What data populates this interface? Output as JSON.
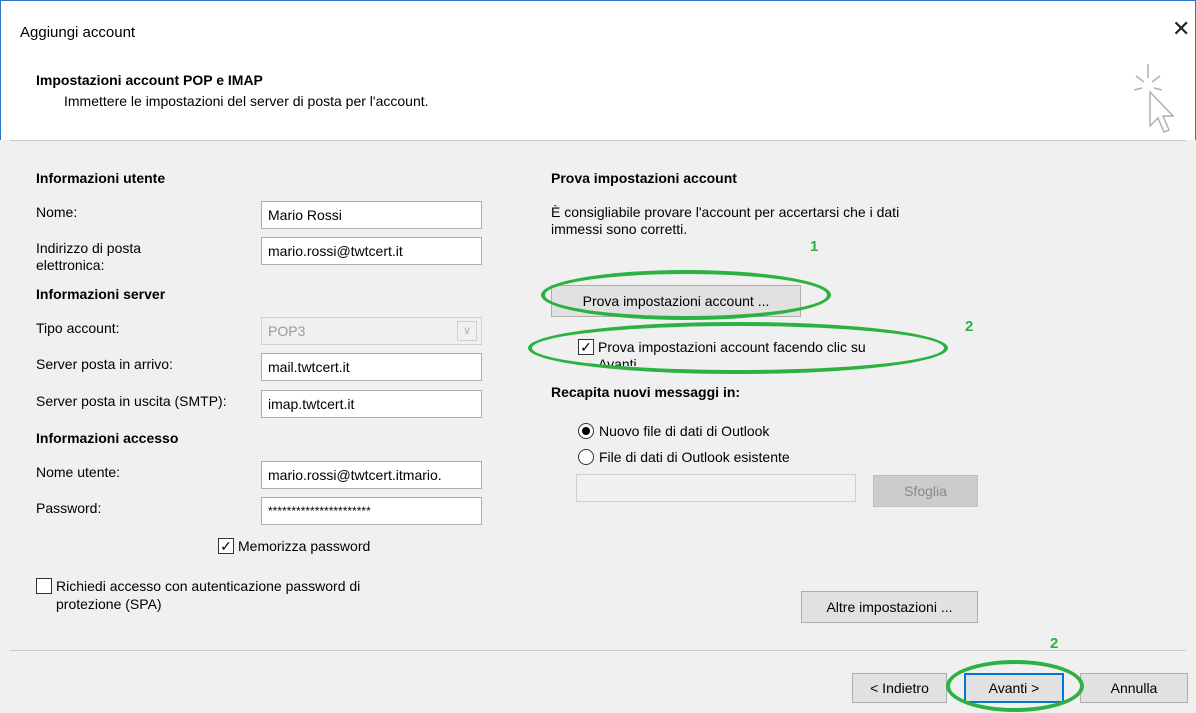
{
  "window": {
    "title": "Aggiungi account",
    "close_icon": "close-icon"
  },
  "header": {
    "heading": "Impostazioni account POP e IMAP",
    "subheading": "Immettere le impostazioni del server di posta per l'account."
  },
  "user_info": {
    "section": "Informazioni utente",
    "name_label": "Nome:",
    "name_value": "Mario Rossi",
    "email_label_1": "Indirizzo di posta",
    "email_label_2": "elettronica:",
    "email_value": "mario.rossi@twtcert.it"
  },
  "server_info": {
    "section": "Informazioni server",
    "account_type_label": "Tipo account:",
    "account_type_value": "POP3",
    "incoming_label": "Server posta in arrivo:",
    "incoming_value": "mail.twtcert.it",
    "outgoing_label": "Server posta in uscita (SMTP):",
    "outgoing_value": "imap.twtcert.it"
  },
  "login_info": {
    "section": "Informazioni accesso",
    "username_label": "Nome utente:",
    "username_value": "mario.rossi@twtcert.itmario.",
    "password_label": "Password:",
    "password_value": "**********************",
    "remember_label": "Memorizza password",
    "remember_checked": true,
    "spa_label_1": "Richiedi accesso con autenticazione password di",
    "spa_label_2": "protezione (SPA)",
    "spa_checked": false
  },
  "test": {
    "section": "Prova impostazioni account",
    "desc_1": "È consigliabile provare l'account per accertarsi che i dati",
    "desc_2": "immessi sono corretti.",
    "test_button": "Prova impostazioni account ...",
    "auto_test_label_1": "Prova impostazioni account facendo clic su",
    "auto_test_label_2": "Avanti",
    "auto_test_checked": true
  },
  "deliver": {
    "section": "Recapita nuovi messaggi in:",
    "option_new": "Nuovo file di dati di Outlook",
    "option_existing": "File di dati di Outlook esistente",
    "selected": "new",
    "path_value": "",
    "browse_button": "Sfoglia"
  },
  "more_settings_button": "Altre impostazioni ...",
  "footer": {
    "back_button": "< Indietro",
    "next_button": "Avanti >",
    "cancel_button": "Annulla"
  },
  "annotations": {
    "num_1": "1",
    "num_2a": "2",
    "num_2b": "2",
    "color": "#2db242"
  }
}
